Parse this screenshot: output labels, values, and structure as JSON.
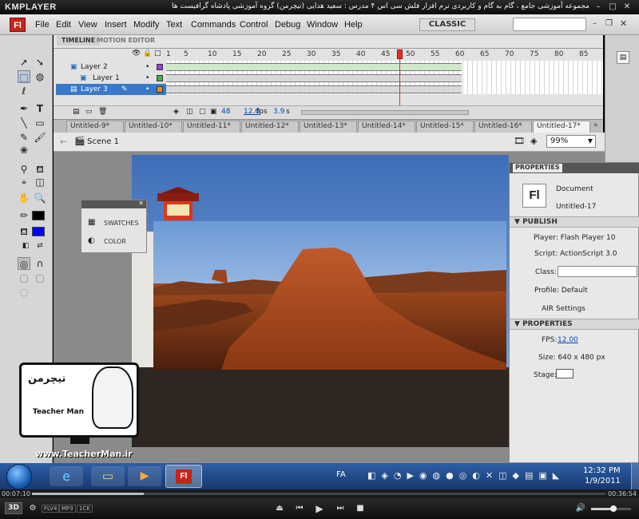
{
  "player": {
    "name": "KMPLAYER",
    "caption": "مجموعه آموزشی جامع ، گام به گام و کاربردی نرم افزار فلش سی اس ۴ مدرس : سعید هدایی (تیچرمن) گروه آموزشی پادشاه گرافیست ها",
    "time_current": "00:07:10",
    "time_total": "00:36:54",
    "badges": [
      "FLV4",
      "MP3",
      "1CK"
    ],
    "mode": "3D"
  },
  "app": {
    "logo": "Fl",
    "menu": [
      "File",
      "Edit",
      "View",
      "Insert",
      "Modify",
      "Text",
      "Commands",
      "Control",
      "Debug",
      "Window",
      "Help"
    ],
    "workspace": "CLASSIC"
  },
  "timeline": {
    "tabs": [
      "TIMELINE",
      "MOTION EDITOR"
    ],
    "layers": [
      "Layer 2",
      "Layer 1",
      "Layer 3"
    ],
    "frame_numbers": [
      "1",
      "5",
      "10",
      "15",
      "20",
      "25",
      "30",
      "35",
      "40",
      "45",
      "50",
      "55",
      "60",
      "65",
      "70",
      "75",
      "80",
      "85"
    ],
    "current_frame": "48",
    "fps": "12.0",
    "fps_unit": "fps",
    "time": "3.9",
    "time_unit": "s"
  },
  "doc_tabs": [
    "Untitled-9*",
    "Untitled-10*",
    "Untitled-11*",
    "Untitled-12*",
    "Untitled-13*",
    "Untitled-14*",
    "Untitled-15*",
    "Untitled-16*",
    "Untitled-17*"
  ],
  "edit_bar": {
    "scene": "Scene 1",
    "zoom": "99%"
  },
  "swatch_panel": {
    "items": [
      "SWATCHES",
      "COLOR"
    ]
  },
  "properties": {
    "tab": "PROPERTIES",
    "doc_type": "Document",
    "doc_name": "Untitled-17",
    "publish_header": "PUBLISH",
    "player": "Player: Flash Player 10",
    "script": "Script: ActionScript 3.0",
    "class_label": "Class:",
    "profile": "Profile: Default",
    "air": "AIR Settings",
    "props_header": "PROPERTIES",
    "fps_label": "FPS:",
    "fps_value": "12.00",
    "size": "Size: 640 x 480 px",
    "stage_label": "Stage:"
  },
  "watermark": {
    "url": "www.TeacherMan.ir",
    "text": "Teacher Man",
    "fa": "تیچرمن"
  },
  "taskbar": {
    "time": "12:32 PM",
    "date": "1/9/2011",
    "lang": "FA"
  },
  "colors": {
    "flash_red": "#c6231b",
    "tween_green": "#cfe8c9",
    "playhead": "#e0302a",
    "fill_blue": "#0000ff",
    "stroke_black": "#000000",
    "taskbar": "#2d5fa6"
  }
}
